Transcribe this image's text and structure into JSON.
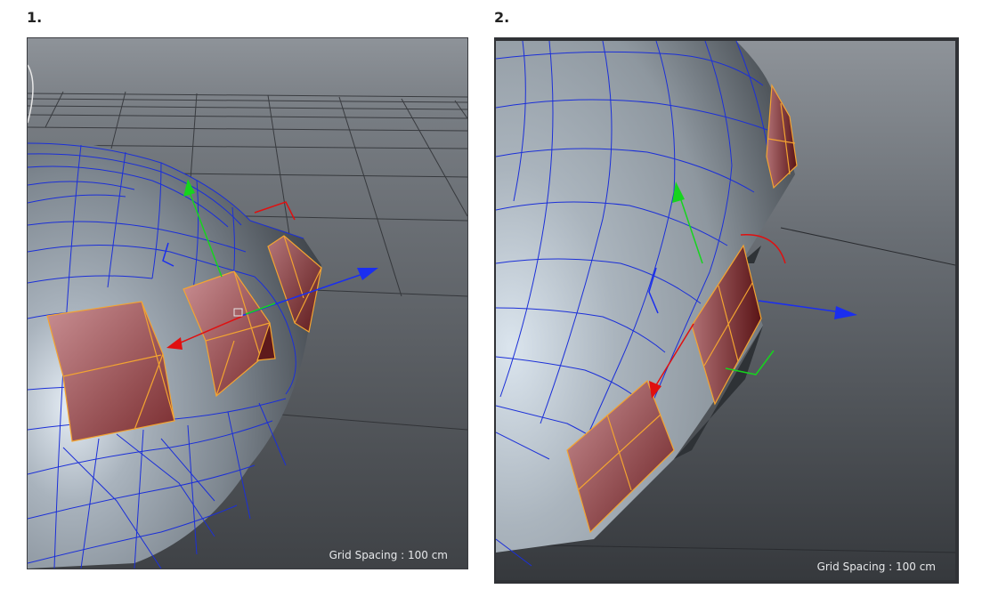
{
  "panels": [
    {
      "step_label": "1.",
      "grid_spacing": "Grid Spacing : 100 cm"
    },
    {
      "step_label": "2.",
      "grid_spacing": "Grid Spacing : 100 cm"
    }
  ],
  "colors": {
    "wireframe": "#1b2fd8",
    "selection_edge": "#f3a431",
    "selected_face": "#8a3a3c",
    "axis_x": "#e01010",
    "axis_y": "#16d41e",
    "axis_z": "#1a2ef0",
    "viewport_bg": "#55595e"
  }
}
